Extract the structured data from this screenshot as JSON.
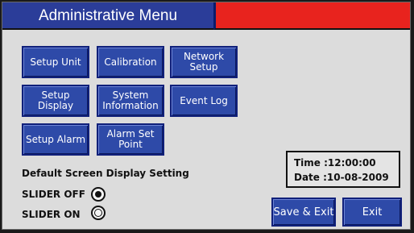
{
  "header": {
    "title": "Administrative Menu"
  },
  "menu_buttons": [
    {
      "label": "Setup Unit"
    },
    {
      "label": "Calibration"
    },
    {
      "label": "Network\nSetup"
    },
    {
      "label": "Setup\nDisplay"
    },
    {
      "label": "System\nInformation"
    },
    {
      "label": "Event Log"
    },
    {
      "label": "Setup Alarm"
    },
    {
      "label": "Alarm Set\nPoint"
    }
  ],
  "display_setting": {
    "heading": "Default Screen Display Setting",
    "options": [
      {
        "label": "SLIDER OFF",
        "selected": true
      },
      {
        "label": "SLIDER ON",
        "selected": false
      }
    ]
  },
  "clock": {
    "time_text": "Time :12:00:00",
    "date_text": "Date :10-08-2009"
  },
  "actions": {
    "save_exit": "Save & Exit",
    "exit": "Exit"
  },
  "colors": {
    "button_blue": "#2e4aa8",
    "title_blue": "#2b3d99",
    "title_red": "#e8231e",
    "panel_gray": "#dcdcdc"
  }
}
